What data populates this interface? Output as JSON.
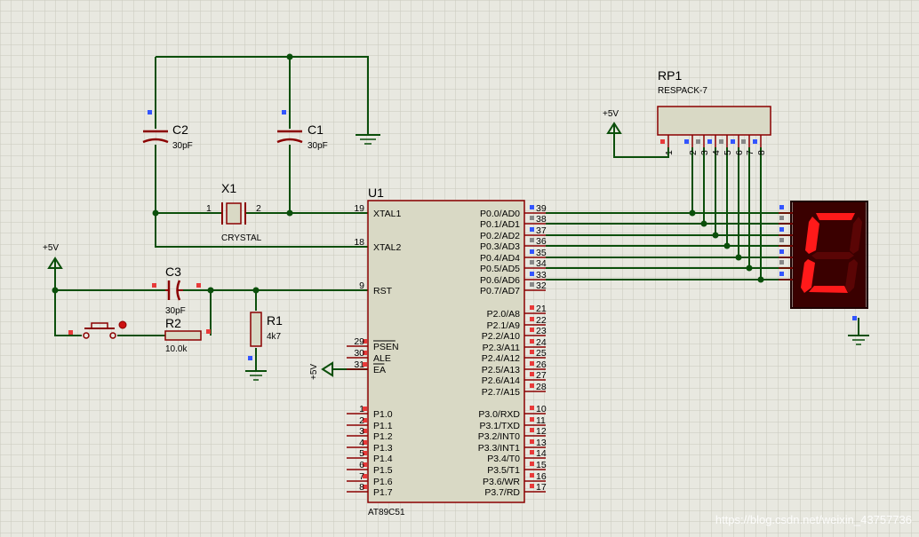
{
  "components": {
    "c2": {
      "ref": "C2",
      "value": "30pF"
    },
    "c1": {
      "ref": "C1",
      "value": "30pF"
    },
    "x1": {
      "ref": "X1",
      "value": "CRYSTAL",
      "pin1": "1",
      "pin2": "2"
    },
    "c3": {
      "ref": "C3",
      "value": "30pF"
    },
    "r2": {
      "ref": "R2",
      "value": "10.0k"
    },
    "r1": {
      "ref": "R1",
      "value": "4k7"
    },
    "rp1": {
      "ref": "RP1",
      "value": "RESPACK-7",
      "pins": [
        "1",
        "2",
        "3",
        "4",
        "5",
        "6",
        "7",
        "8"
      ]
    },
    "u1": {
      "ref": "U1",
      "part": "AT89C51"
    }
  },
  "power": {
    "vcc_left": "+5V",
    "vcc_rp": "+5V",
    "vcc_ea": "+5V"
  },
  "u1_left_pins": [
    {
      "num": "19",
      "name": "XTAL1"
    },
    {
      "num": "18",
      "name": "XTAL2"
    },
    {
      "num": "9",
      "name": "RST"
    },
    {
      "num": "29",
      "name": "PSEN"
    },
    {
      "num": "30",
      "name": "ALE"
    },
    {
      "num": "31",
      "name": "EA"
    },
    {
      "num": "1",
      "name": "P1.0"
    },
    {
      "num": "2",
      "name": "P1.1"
    },
    {
      "num": "3",
      "name": "P1.2"
    },
    {
      "num": "4",
      "name": "P1.3"
    },
    {
      "num": "5",
      "name": "P1.4"
    },
    {
      "num": "6",
      "name": "P1.5"
    },
    {
      "num": "7",
      "name": "P1.6"
    },
    {
      "num": "8",
      "name": "P1.7"
    }
  ],
  "u1_right_pins": [
    {
      "num": "39",
      "name": "P0.0/AD0"
    },
    {
      "num": "38",
      "name": "P0.1/AD1"
    },
    {
      "num": "37",
      "name": "P0.2/AD2"
    },
    {
      "num": "36",
      "name": "P0.3/AD3"
    },
    {
      "num": "35",
      "name": "P0.4/AD4"
    },
    {
      "num": "34",
      "name": "P0.5/AD5"
    },
    {
      "num": "33",
      "name": "P0.6/AD6"
    },
    {
      "num": "32",
      "name": "P0.7/AD7"
    },
    {
      "num": "21",
      "name": "P2.0/A8"
    },
    {
      "num": "22",
      "name": "P2.1/A9"
    },
    {
      "num": "23",
      "name": "P2.2/A10"
    },
    {
      "num": "24",
      "name": "P2.3/A11"
    },
    {
      "num": "25",
      "name": "P2.4/A12"
    },
    {
      "num": "26",
      "name": "P2.5/A13"
    },
    {
      "num": "27",
      "name": "P2.6/A14"
    },
    {
      "num": "28",
      "name": "P2.7/A15"
    },
    {
      "num": "10",
      "name": "P3.0/RXD"
    },
    {
      "num": "11",
      "name": "P3.1/TXD"
    },
    {
      "num": "12",
      "name": "P3.2/INT0"
    },
    {
      "num": "13",
      "name": "P3.3/INT1"
    },
    {
      "num": "14",
      "name": "P3.4/T0"
    },
    {
      "num": "15",
      "name": "P3.5/T1"
    },
    {
      "num": "16",
      "name": "P3.6/WR"
    },
    {
      "num": "17",
      "name": "P3.7/RD"
    }
  ],
  "watermark": "https://blog.csdn.net/weixin_43757736",
  "colors": {
    "wire": "#0b4f0b",
    "component": "#8b0000",
    "chip_fill": "#d9d9c5",
    "segment_on": "#ff1a1a",
    "display_bg": "#3a0000"
  }
}
